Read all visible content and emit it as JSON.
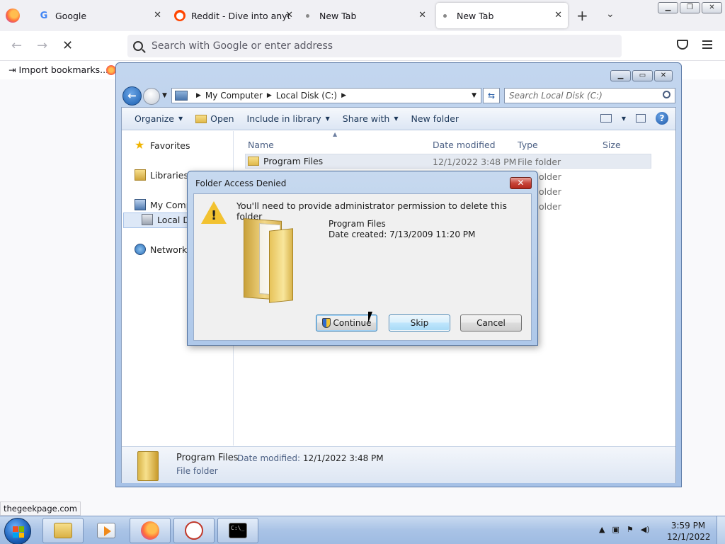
{
  "browser": {
    "tabs": [
      {
        "label": "Google",
        "favicon": "google-icon"
      },
      {
        "label": "Reddit - Dive into anythin",
        "favicon": "reddit-icon"
      },
      {
        "label": "New Tab",
        "favicon": "dot"
      },
      {
        "label": "New Tab",
        "favicon": "dot",
        "active": true
      }
    ],
    "url_placeholder": "Search with Google or enter address",
    "bookmark": "Import bookmarks...",
    "status_link": "thegeekpage.com"
  },
  "explorer": {
    "breadcrumb": [
      "My Computer",
      "Local Disk (C:)"
    ],
    "search_placeholder": "Search Local Disk (C:)",
    "commands": [
      "Organize",
      "Open",
      "Include in library",
      "Share with",
      "New folder"
    ],
    "nav": {
      "favorites": "Favorites",
      "libraries": "Libraries",
      "computer": "My Comp",
      "local_disk": "Local Di",
      "network": "Network"
    },
    "columns": [
      "Name",
      "Date modified",
      "Type",
      "Size"
    ],
    "rows": [
      {
        "name": "Program Files",
        "date": "12/1/2022 3:48 PM",
        "type": "File folder"
      },
      {
        "type_partial": "older"
      },
      {
        "type_partial": "older"
      },
      {
        "type_partial": "older"
      }
    ],
    "details": {
      "name": "Program Files",
      "modified_label": "Date modified:",
      "modified_value": "12/1/2022 3:48 PM",
      "type": "File folder"
    }
  },
  "dialog": {
    "title": "Folder Access Denied",
    "message": "You'll need to provide administrator permission to delete this folder",
    "folder_name": "Program Files",
    "date_created": "Date created: 7/13/2009 11:20 PM",
    "buttons": {
      "continue": "Continue",
      "skip": "Skip",
      "cancel": "Cancel"
    }
  },
  "taskbar": {
    "time": "3:59 PM",
    "date": "12/1/2022"
  },
  "colors": {
    "accent": "#3c7fb1",
    "dialog_close": "#c8463a",
    "folder": "#e0b94a"
  }
}
